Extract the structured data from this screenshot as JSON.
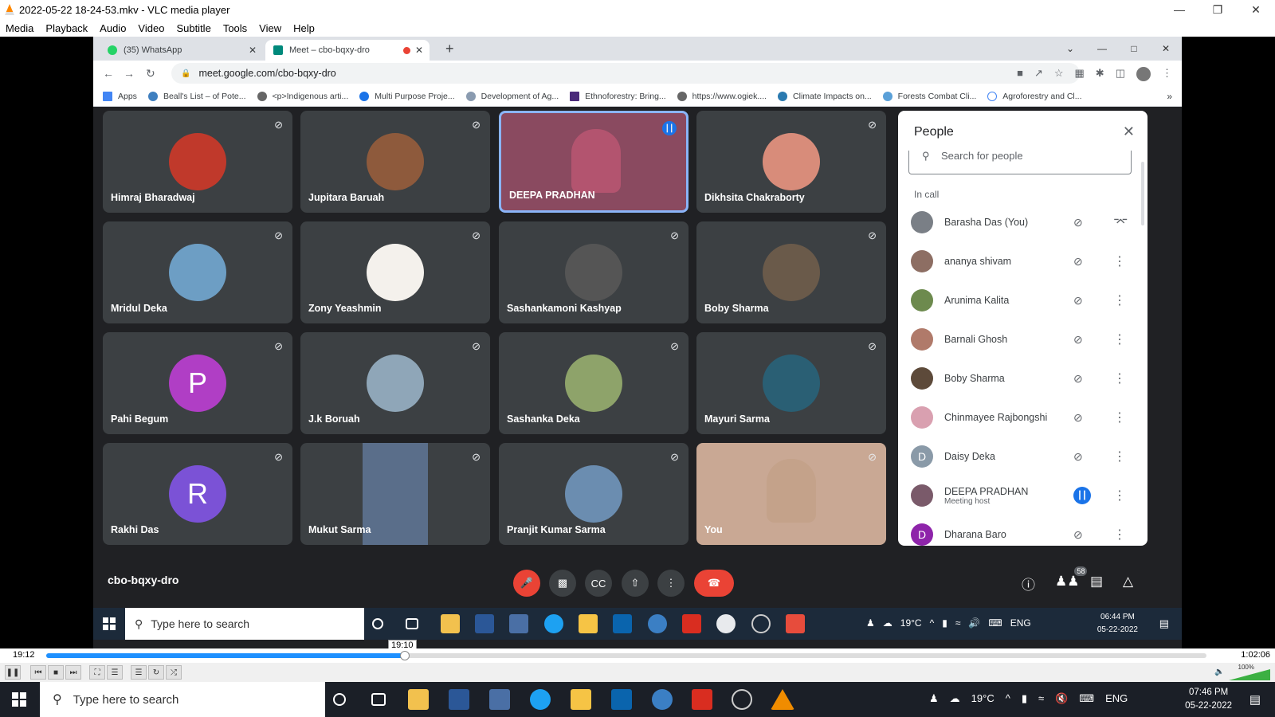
{
  "vlc": {
    "title": "2022-05-22 18-24-53.mkv - VLC media player",
    "menu": [
      "Media",
      "Playback",
      "Audio",
      "Video",
      "Subtitle",
      "Tools",
      "View",
      "Help"
    ],
    "elapsed": "19:12",
    "total": "1:02:06",
    "progress_fraction": 0.309,
    "volume": "100%",
    "volume_fraction": 1.0,
    "seek_tooltip": "19:10"
  },
  "browser": {
    "tabs": [
      {
        "label": "(35) WhatsApp",
        "color": "#25d366"
      },
      {
        "label": "Meet – cbo-bqxy-dro",
        "color": "#00897b"
      }
    ],
    "url": "meet.google.com/cbo-bqxy-dro",
    "bookmarks": [
      "Apps",
      "Beall's List – of Pote...",
      "<p>Indigenous arti...",
      "Multi Purpose Proje...",
      "Development of Ag...",
      "Ethnoforestry: Bring...",
      "https://www.ogiek....",
      "Climate Impacts on...",
      "Forests Combat Cli...",
      "Agroforestry and Cl..."
    ]
  },
  "meet": {
    "code": "cbo-bqxy-dro",
    "participant_count": "58",
    "tiles": [
      {
        "name": "Himraj Bharadwaj",
        "color": "#c0392b"
      },
      {
        "name": "Jupitara Baruah",
        "color": "#8e5a3c"
      },
      {
        "name": "DEEPA PRADHAN",
        "color": "#b3546f"
      },
      {
        "name": "Dikhsita Chakraborty",
        "color": "#d88c7a"
      },
      {
        "name": "Mridul Deka",
        "color": "#6d9ec4"
      },
      {
        "name": "Zony Yeashmin",
        "color": "#f4f1ec"
      },
      {
        "name": "Sashankamoni Kashyap",
        "color": "#555555"
      },
      {
        "name": "Boby Sharma",
        "color": "#6a5a4a"
      },
      {
        "name": "Pahi Begum",
        "letter": "P",
        "color": "#b03ec5"
      },
      {
        "name": "J.k Boruah",
        "color": "#8fa6b8"
      },
      {
        "name": "Sashanka Deka",
        "color": "#8ea36a"
      },
      {
        "name": "Mayuri Sarma",
        "color": "#2a5f74"
      },
      {
        "name": "Rakhi Das",
        "letter": "R",
        "color": "#7b52d6"
      },
      {
        "name": "Mukut Sarma",
        "color": "#5a6e8a"
      },
      {
        "name": "Pranjit Kumar Sarma",
        "color": "#6b8db0"
      },
      {
        "name": "You",
        "color": "#c4a28a"
      }
    ],
    "people_panel": {
      "title": "People",
      "search_placeholder": "Search for people",
      "section": "In call",
      "people": [
        {
          "name": "Barasha Das (You)",
          "color": "#7a7f86"
        },
        {
          "name": "ananya shivam",
          "color": "#8d6e63"
        },
        {
          "name": "Arunima Kalita",
          "color": "#6d8a4e"
        },
        {
          "name": "Barnali Ghosh",
          "color": "#b07a6a"
        },
        {
          "name": "Boby Sharma",
          "color": "#5d4a3a"
        },
        {
          "name": "Chinmayee Rajbongshi",
          "color": "#d9a0b0"
        },
        {
          "name": "Daisy Deka",
          "letter": "D",
          "color": "#8a9aa8"
        },
        {
          "name": "DEEPA PRADHAN",
          "sub": "Meeting host",
          "color": "#7a5a6a"
        },
        {
          "name": "Dharana Baro",
          "letter": "D",
          "color": "#8e24aa"
        }
      ]
    }
  },
  "inner_taskbar": {
    "search": "Type here to search",
    "weather": "19°C",
    "lang": "ENG",
    "time": "06:44 PM",
    "date": "05-22-2022"
  },
  "outer_taskbar": {
    "search": "Type here to search",
    "weather": "19°C",
    "lang": "ENG",
    "time": "07:46 PM",
    "date": "05-22-2022"
  }
}
